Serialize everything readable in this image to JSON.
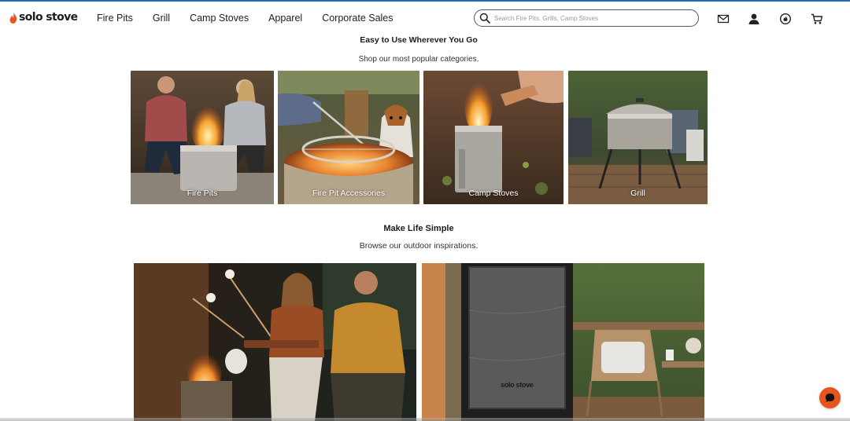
{
  "header": {
    "logo_text": "solo stove",
    "nav": [
      "Fire Pits",
      "Grill",
      "Camp Stoves",
      "Apparel",
      "Corporate Sales"
    ],
    "search_placeholder": "Search Fire Pits, Grills, Camp Stoves",
    "icons": [
      "mail-icon",
      "account-icon",
      "solo-stove-rewards-icon",
      "cart-icon"
    ]
  },
  "categories_section": {
    "title": "Easy to Use Wherever You Go",
    "subtitle": "Shop our most popular categories.",
    "tiles": [
      {
        "label": "Fire Pits"
      },
      {
        "label": "Fire Pit Accessories"
      },
      {
        "label": "Camp Stoves"
      },
      {
        "label": "Grill"
      }
    ]
  },
  "inspiration_section": {
    "title": "Make Life Simple",
    "subtitle": "Browse our outdoor inspirations.",
    "blanket_brand": "solo stove"
  },
  "chat": {
    "icon": "chat-bubble-icon"
  },
  "colors": {
    "brand_orange": "#e8541e",
    "accent_blue": "#1f6fb5"
  }
}
